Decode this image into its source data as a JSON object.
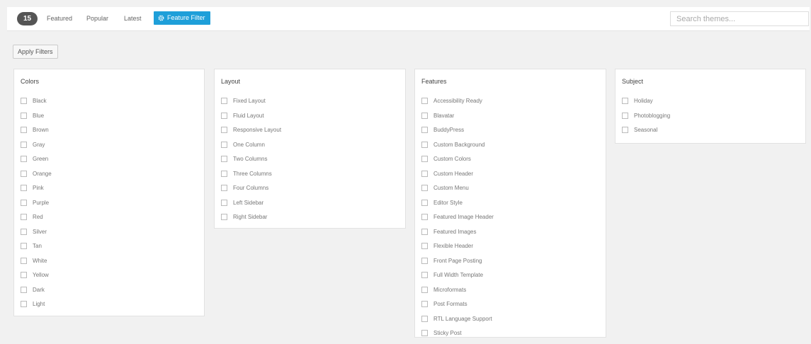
{
  "header": {
    "count": "15",
    "tabs": [
      {
        "label": "Featured"
      },
      {
        "label": "Popular"
      },
      {
        "label": "Latest"
      }
    ],
    "feature_filter_label": "Feature Filter",
    "search_placeholder": "Search themes...",
    "accent_color": "#1e9fd9"
  },
  "apply_filters_label": "Apply Filters",
  "filters": {
    "colors": {
      "title": "Colors",
      "options": [
        "Black",
        "Blue",
        "Brown",
        "Gray",
        "Green",
        "Orange",
        "Pink",
        "Purple",
        "Red",
        "Silver",
        "Tan",
        "White",
        "Yellow",
        "Dark",
        "Light"
      ]
    },
    "layout": {
      "title": "Layout",
      "options": [
        "Fixed Layout",
        "Fluid Layout",
        "Responsive Layout",
        "One Column",
        "Two Columns",
        "Three Columns",
        "Four Columns",
        "Left Sidebar",
        "Right Sidebar"
      ]
    },
    "features": {
      "title": "Features",
      "options": [
        "Accessibility Ready",
        "Blavatar",
        "BuddyPress",
        "Custom Background",
        "Custom Colors",
        "Custom Header",
        "Custom Menu",
        "Editor Style",
        "Featured Image Header",
        "Featured Images",
        "Flexible Header",
        "Front Page Posting",
        "Full Width Template",
        "Microformats",
        "Post Formats",
        "RTL Language Support",
        "Sticky Post"
      ]
    },
    "subject": {
      "title": "Subject",
      "options": [
        "Holiday",
        "Photoblogging",
        "Seasonal"
      ]
    }
  }
}
